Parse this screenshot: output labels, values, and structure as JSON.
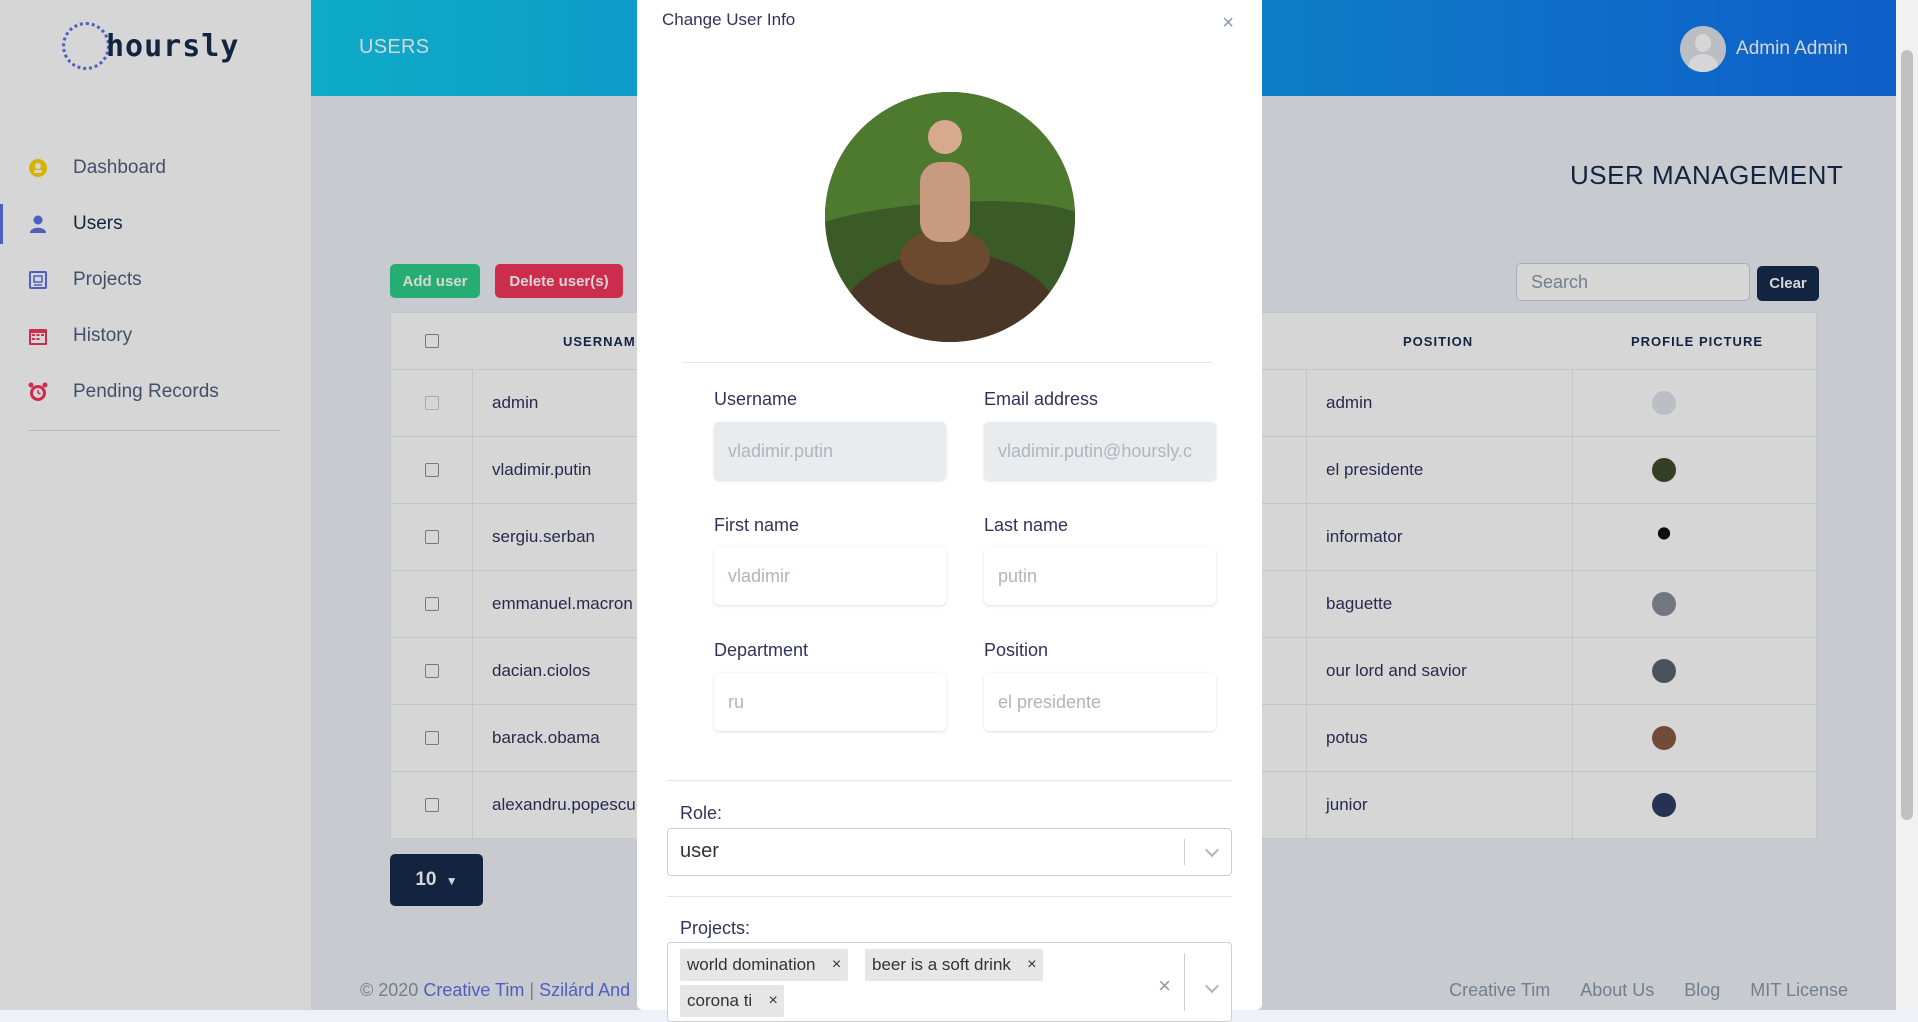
{
  "sidebar": {
    "logo_text": "hoursly",
    "items": [
      {
        "label": "Dashboard",
        "icon": "dashboard-icon",
        "color": "#ffd600"
      },
      {
        "label": "Users",
        "icon": "user-icon",
        "color": "#5e72e4"
      },
      {
        "label": "Projects",
        "icon": "projects-icon",
        "color": "#5e72e4"
      },
      {
        "label": "History",
        "icon": "calendar-icon",
        "color": "#f5365c"
      },
      {
        "label": "Pending Records",
        "icon": "alarm-clock-icon",
        "color": "#f5365c"
      }
    ]
  },
  "header": {
    "title": "USERS",
    "user_name": "Admin Admin"
  },
  "main": {
    "title": "USER MANAGEMENT",
    "add_label": "Add user",
    "delete_label": "Delete user(s)",
    "search_placeholder": "Search",
    "clear_label": "Clear",
    "table": {
      "headers": {
        "username": "USERNAM",
        "position": "POSITION",
        "picture": "PROFILE PICTURE"
      },
      "rows": [
        {
          "username": "admin",
          "position": "admin"
        },
        {
          "username": "vladimir.putin",
          "position": "el presidente"
        },
        {
          "username": "sergiu.serban",
          "position": "informator"
        },
        {
          "username": "emmanuel.macron",
          "position": "baguette"
        },
        {
          "username": "dacian.ciolos",
          "position": "our lord and savior"
        },
        {
          "username": "barack.obama",
          "position": "potus"
        },
        {
          "username": "alexandru.popescu",
          "position": "junior"
        }
      ]
    },
    "page_size": "10"
  },
  "footer": {
    "copyright": "© 2020",
    "link1": "Creative Tim",
    "sep": "|",
    "link2": "Szilárd And",
    "links": [
      "Creative Tim",
      "About Us",
      "Blog",
      "MIT License"
    ]
  },
  "modal": {
    "title": "Change User Info",
    "close": "×",
    "username_label": "Username",
    "username_value": "vladimir.putin",
    "email_label": "Email address",
    "email_value": "vladimir.putin@hoursly.c",
    "first_label": "First name",
    "first_value": "vladimir",
    "last_label": "Last name",
    "last_value": "putin",
    "department_label": "Department",
    "department_value": "ru",
    "position_label": "Position",
    "position_value": "el presidente",
    "role_label": "Role:",
    "role_value": "user",
    "projects_label": "Projects:",
    "projects": [
      "world domination",
      "beer is a soft drink",
      "corona ti"
    ],
    "chip_remove": "×",
    "clear_all": "×"
  }
}
